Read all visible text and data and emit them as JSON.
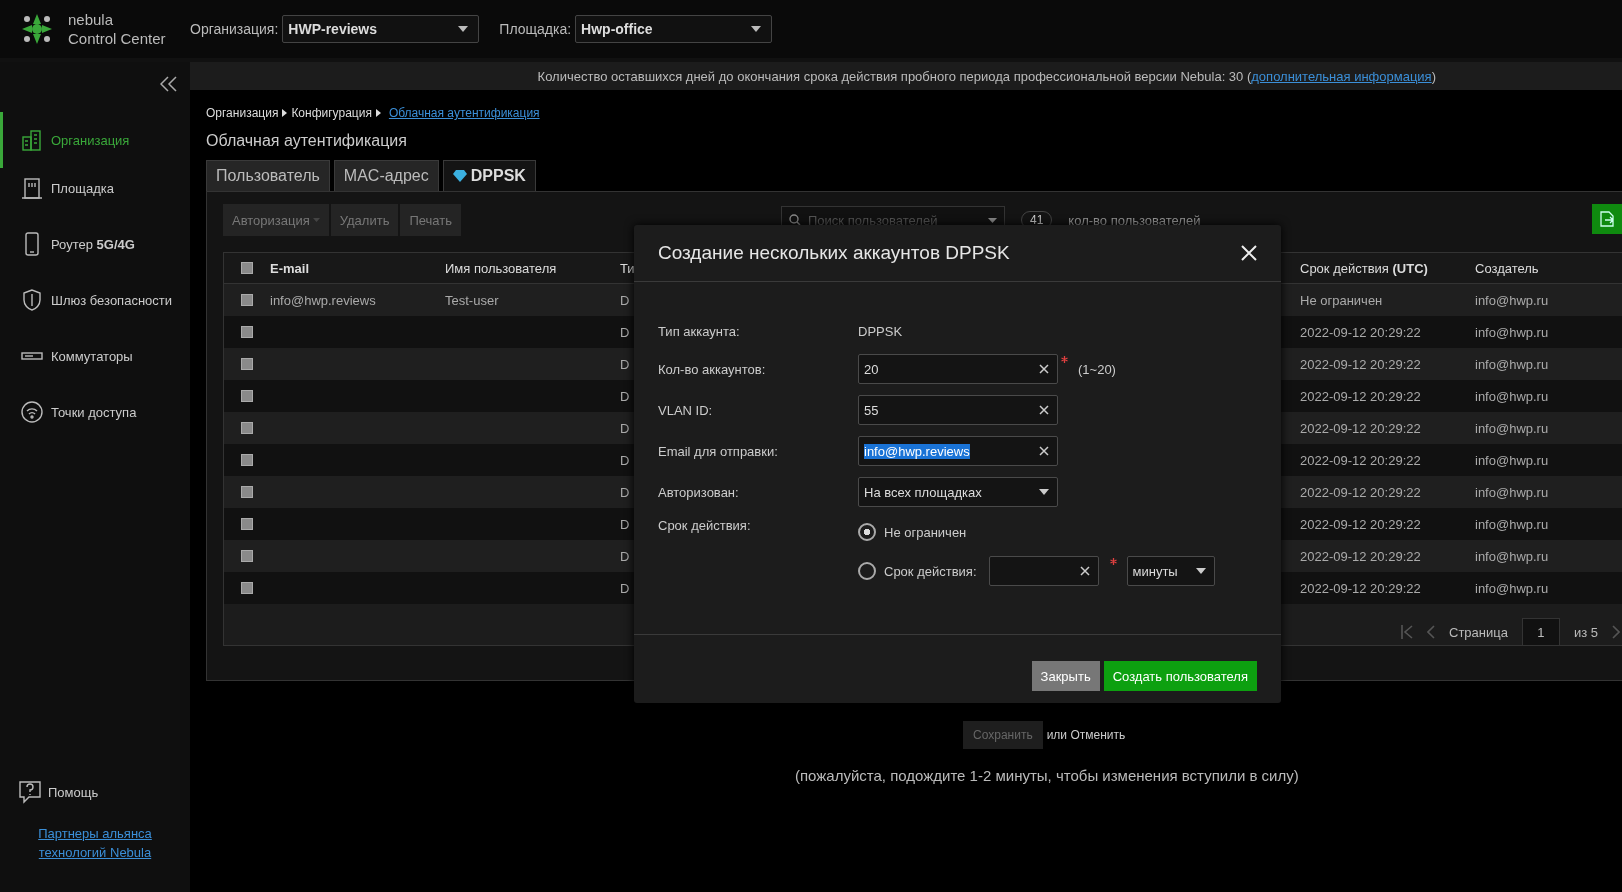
{
  "header": {
    "logo_line1": "nebula",
    "logo_line2": "Control Center",
    "org_label": "Организация:",
    "org_value": "HWP-reviews",
    "site_label": "Площадка:",
    "site_value": "Hwp-office"
  },
  "banner": {
    "text": "Количество оставшихся дней до окончания срока действия пробного периода профессиональной версии Nebula: 30 (",
    "link": "дополнительная информация",
    "tail": ")"
  },
  "sidebar": {
    "items": [
      {
        "label": "Организация",
        "selected": true
      },
      {
        "label": "Площадка",
        "selected": false
      },
      {
        "label": "Роутер **5G/4G**",
        "selected": false
      },
      {
        "label": "Шлюз безопасности",
        "selected": false
      },
      {
        "label": "Коммутаторы",
        "selected": false
      },
      {
        "label": "Точки доступа",
        "selected": false
      }
    ],
    "help": "Помощь",
    "partners": "Партнеры альянса технологий Nebula"
  },
  "breadcrumb": [
    "Организация",
    "Конфигурация"
  ],
  "breadcrumb_current": "Облачная аутентификация",
  "page_title": "Облачная аутентификация",
  "tabs": [
    {
      "label": "Пользователь",
      "selected": false,
      "gem": false
    },
    {
      "label": "MAC-адрес",
      "selected": false,
      "gem": false
    },
    {
      "label": "DPPSK",
      "selected": true,
      "gem": true
    }
  ],
  "toolbar": {
    "buttons": [
      {
        "label": "Авторизация",
        "dropdown": true,
        "disabled": true
      },
      {
        "label": "Удалить",
        "dropdown": false,
        "disabled": true
      },
      {
        "label": "Печать",
        "dropdown": false,
        "disabled": true
      }
    ],
    "search_placeholder": "Поиск пользователей",
    "count": "41",
    "count_label": "кол-во пользователей"
  },
  "table": {
    "select_all_checked": false,
    "columns": [
      "E-mail",
      "Имя пользователя",
      "Ти",
      "Срок действия **(UTC)**",
      "Создатель"
    ],
    "rows": [
      {
        "checked": false,
        "email": "info@hwp.reviews",
        "username": "Test-user",
        "column_3": "D",
        "expiry": "Не ограничен",
        "creator": "info@hwp.ru"
      },
      {
        "checked": false,
        "email": "",
        "username": "",
        "column_3": "D",
        "expiry": "2022-09-12 20:29:22",
        "creator": "info@hwp.ru"
      },
      {
        "checked": false,
        "email": "",
        "username": "",
        "column_3": "D",
        "expiry": "2022-09-12 20:29:22",
        "creator": "info@hwp.ru"
      },
      {
        "checked": false,
        "email": "",
        "username": "",
        "column_3": "D",
        "expiry": "2022-09-12 20:29:22",
        "creator": "info@hwp.ru"
      },
      {
        "checked": false,
        "email": "",
        "username": "",
        "column_3": "D",
        "expiry": "2022-09-12 20:29:22",
        "creator": "info@hwp.ru"
      },
      {
        "checked": false,
        "email": "",
        "username": "",
        "column_3": "D",
        "expiry": "2022-09-12 20:29:22",
        "creator": "info@hwp.ru"
      },
      {
        "checked": false,
        "email": "",
        "username": "",
        "column_3": "D",
        "expiry": "2022-09-12 20:29:22",
        "creator": "info@hwp.ru"
      },
      {
        "checked": false,
        "email": "",
        "username": "",
        "column_3": "D",
        "expiry": "2022-09-12 20:29:22",
        "creator": "info@hwp.ru"
      },
      {
        "checked": false,
        "email": "",
        "username": "",
        "column_3": "D",
        "expiry": "2022-09-12 20:29:22",
        "creator": "info@hwp.ru"
      },
      {
        "checked": false,
        "email": "",
        "username": "",
        "column_3": "D",
        "expiry": "2022-09-12 20:29:22",
        "creator": "info@hwp.ru"
      }
    ],
    "pagination": {
      "label": "Страница",
      "page": "1",
      "total": "из 5"
    }
  },
  "save": {
    "button": "Сохранить",
    "or_cancel": "или Отменить",
    "note": "(пожалуйста, подождите 1-2 минуты, чтобы изменения вступили в силу)"
  },
  "dialog": {
    "title": "Создание нескольких аккаунтов DPPSK",
    "fields": [
      {
        "kind": "static",
        "label": "Тип аккаунта:",
        "value": "DPPSK"
      },
      {
        "kind": "input",
        "label": "Кол-во аккаунтов:",
        "value": "20",
        "required": true,
        "hint": "(1~20)",
        "highlighted": false
      },
      {
        "kind": "input",
        "label": "VLAN ID:",
        "value": "55",
        "highlighted": false
      },
      {
        "kind": "input",
        "label": "Email для отправки:",
        "value": "info@hwp.reviews",
        "highlighted": true
      },
      {
        "kind": "select",
        "label": "Авторизован:",
        "value": "На всех площадках"
      },
      {
        "kind": "radio",
        "label": "Срок действия:",
        "options": [
          {
            "label": "Не ограничен",
            "selected": true
          },
          {
            "label": "Срок действия:",
            "selected": false,
            "unit": "минуты"
          }
        ]
      }
    ],
    "buttons": [
      {
        "label": "Закрыть",
        "primary": false
      },
      {
        "label": "Создать пользователя",
        "primary": true
      }
    ]
  }
}
